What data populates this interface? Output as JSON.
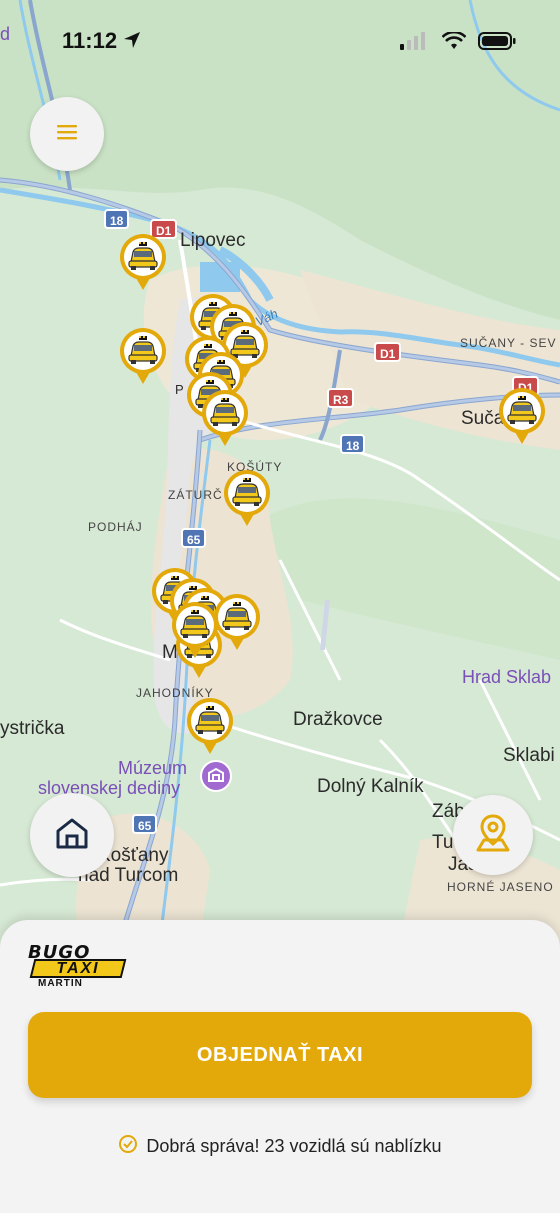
{
  "status_bar": {
    "time": "11:12"
  },
  "map": {
    "place_labels": {
      "lipovec": "Lipovec",
      "sucany": "SUČANY - SEV",
      "sucany_town": "Suča",
      "kosuty": "KOŠÚTY",
      "zaturcie": "ZÁTURČ",
      "podhaj": "PODHÁJ",
      "jahodniky": "JAHODNÍKY",
      "martin_partial": "M",
      "bystricka": "ystrička",
      "drazkovce": "Dražkovce",
      "dolny_kalnik": "Dolný Kalník",
      "sklabina": "Sklabi",
      "zab": "Záb",
      "tu": "Tu",
      "jas": "Jas",
      "horne_jaseno": "HORNÉ JASENO",
      "kostany_1": "Košťany",
      "kostany_2": "nad Turcom",
      "vah": "Váh",
      "corner_d": "d",
      "p_label": "P"
    },
    "poi": {
      "hrad": "Hrad Sklab",
      "muzeum_1": "Múzeum",
      "muzeum_2": "slovenskej dediny"
    },
    "road_shields": {
      "r18a": "18",
      "d1a": "D1",
      "d1b": "D1",
      "d1c": "D1",
      "r3": "R3",
      "r18b": "18",
      "r65a": "65",
      "r65b": "65"
    },
    "taxi_count_shown": 18
  },
  "buttons": {
    "menu_icon": "hamburger-menu-icon",
    "home_icon": "home-icon",
    "pickup_icon": "map-pin-icon"
  },
  "sheet": {
    "logo_line1": "BUGO",
    "logo_line2": "TAXI",
    "logo_line3": "MARTIN",
    "order_button": "OBJEDNAŤ TAXI",
    "status_message": "Dobrá správa! 23 vozidlá sú nablízku"
  },
  "colors": {
    "accent": "#e3a90a",
    "map_green": "#d9ead7",
    "sheet_bg": "#f3f3f3"
  }
}
